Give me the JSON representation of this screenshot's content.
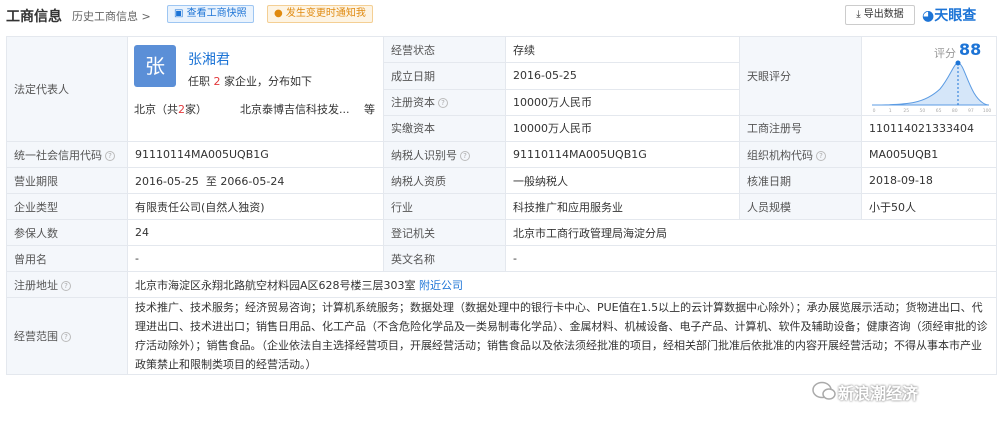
{
  "header": {
    "title": "工商信息",
    "history": "历史工商信息 >",
    "snapshot_btn": "查看工商快照",
    "notify_btn": "发生变更时通知我",
    "export_btn": "导出数据",
    "brand": "天眼查"
  },
  "legal_rep": {
    "label": "法定代表人",
    "avatar_char": "张",
    "name": "张湘君",
    "role_prefix": "任职",
    "role_count": "2",
    "role_suffix": "家企业，分布如下",
    "loc_prefix": "北京（共",
    "loc_count": "2",
    "loc_suffix": "家）",
    "company": "北京泰博吉信科技发...",
    "more": "等"
  },
  "status": {
    "label": "经营状态",
    "value": "存续"
  },
  "founded": {
    "label": "成立日期",
    "value": "2016-05-25"
  },
  "reg_capital": {
    "label": "注册资本",
    "value": "10000万人民币"
  },
  "paid_capital": {
    "label": "实缴资本",
    "value": "10000万人民币"
  },
  "score": {
    "label": "天眼评分",
    "mini_label": "评分",
    "value": "88",
    "axis": [
      "0",
      "1",
      "25",
      "50",
      "65",
      "80",
      "97",
      "100"
    ]
  },
  "reg_no": {
    "label": "工商注册号",
    "value": "110114021333404"
  },
  "credit_code": {
    "label": "统一社会信用代码",
    "value": "91110114MA005UQB1G"
  },
  "taxpayer_id": {
    "label": "纳税人识别号",
    "value": "91110114MA005UQB1G"
  },
  "org_code": {
    "label": "组织机构代码",
    "value": "MA005UQB1"
  },
  "term": {
    "label": "营业期限",
    "value": "2016-05-25  至 2066-05-24"
  },
  "taxpayer_qual": {
    "label": "纳税人资质",
    "value": "一般纳税人"
  },
  "approve_date": {
    "label": "核准日期",
    "value": "2018-09-18"
  },
  "company_type": {
    "label": "企业类型",
    "value": "有限责任公司(自然人独资)"
  },
  "industry": {
    "label": "行业",
    "value": "科技推广和应用服务业"
  },
  "staff_size": {
    "label": "人员规模",
    "value": "小于50人"
  },
  "insured": {
    "label": "参保人数",
    "value": "24"
  },
  "reg_authority": {
    "label": "登记机关",
    "value": "北京市工商行政管理局海淀分局"
  },
  "former_name": {
    "label": "曾用名",
    "value": "-"
  },
  "english_name": {
    "label": "英文名称",
    "value": "-"
  },
  "address": {
    "label": "注册地址",
    "value": "北京市海淀区永翔北路航空材料园A区628号楼三层303室",
    "link": "附近公司"
  },
  "scope": {
    "label": "经营范围",
    "value": "技术推广、技术服务；经济贸易咨询；计算机系统服务；数据处理（数据处理中的银行卡中心、PUE值在1.5以上的云计算数据中心除外）；承办展览展示活动；货物进出口、代理进出口、技术进出口；销售日用品、化工产品（不含危险化学品及一类易制毒化学品）、金属材料、机械设备、电子产品、计算机、软件及辅助设备；健康咨询（须经审批的诊疗活动除外）；销售食品。（企业依法自主选择经营项目，开展经营活动；销售食品以及依法须经批准的项目，经相关部门批准后依批准的内容开展经营活动；不得从事本市产业政策禁止和限制类项目的经营活动。）"
  },
  "watermark": "新浪潮经济"
}
